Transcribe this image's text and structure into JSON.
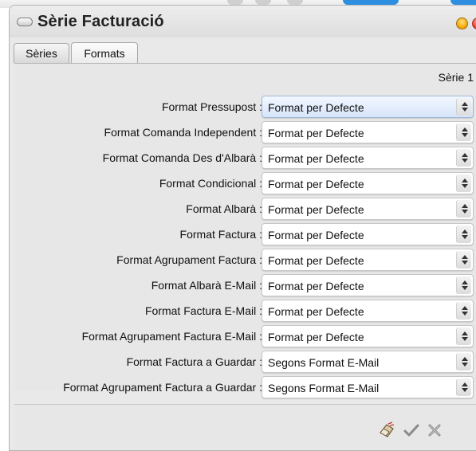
{
  "window": {
    "title": "Sèrie Facturació"
  },
  "tabs": [
    {
      "label": "Sèries",
      "active": false
    },
    {
      "label": "Formats",
      "active": true
    }
  ],
  "panel": {
    "serie_label": "Sèrie 1"
  },
  "rows": [
    {
      "label": "Format Pressupost :",
      "value": "Format per Defecte"
    },
    {
      "label": "Format Comanda Independent :",
      "value": "Format per Defecte"
    },
    {
      "label": "Format Comanda Des d'Albarà :",
      "value": "Format per Defecte"
    },
    {
      "label": "Format Condicional :",
      "value": "Format per Defecte"
    },
    {
      "label": "Format Albarà :",
      "value": "Format per Defecte"
    },
    {
      "label": "Format Factura :",
      "value": "Format per Defecte"
    },
    {
      "label": "Format Agrupament Factura :",
      "value": "Format per Defecte"
    },
    {
      "label": "Format Albarà E-Mail :",
      "value": "Format per Defecte"
    },
    {
      "label": "Format Factura E-Mail :",
      "value": "Format per Defecte"
    },
    {
      "label": "Format Agrupament Factura E-Mail :",
      "value": "Format per Defecte"
    },
    {
      "label": "Format Factura a Guardar :",
      "value": "Segons Format E-Mail"
    },
    {
      "label": "Format Agrupament Factura a Guardar :",
      "value": "Segons Format E-Mail"
    }
  ],
  "footer": {
    "icons": [
      "eraser-icon",
      "checkmark-icon",
      "cancel-icon"
    ]
  },
  "colors": {
    "window_bg": "#e9e9e9",
    "focused_select": "#d6e5fa",
    "close_button": "#f23c28",
    "minimize_button": "#f3a300"
  }
}
